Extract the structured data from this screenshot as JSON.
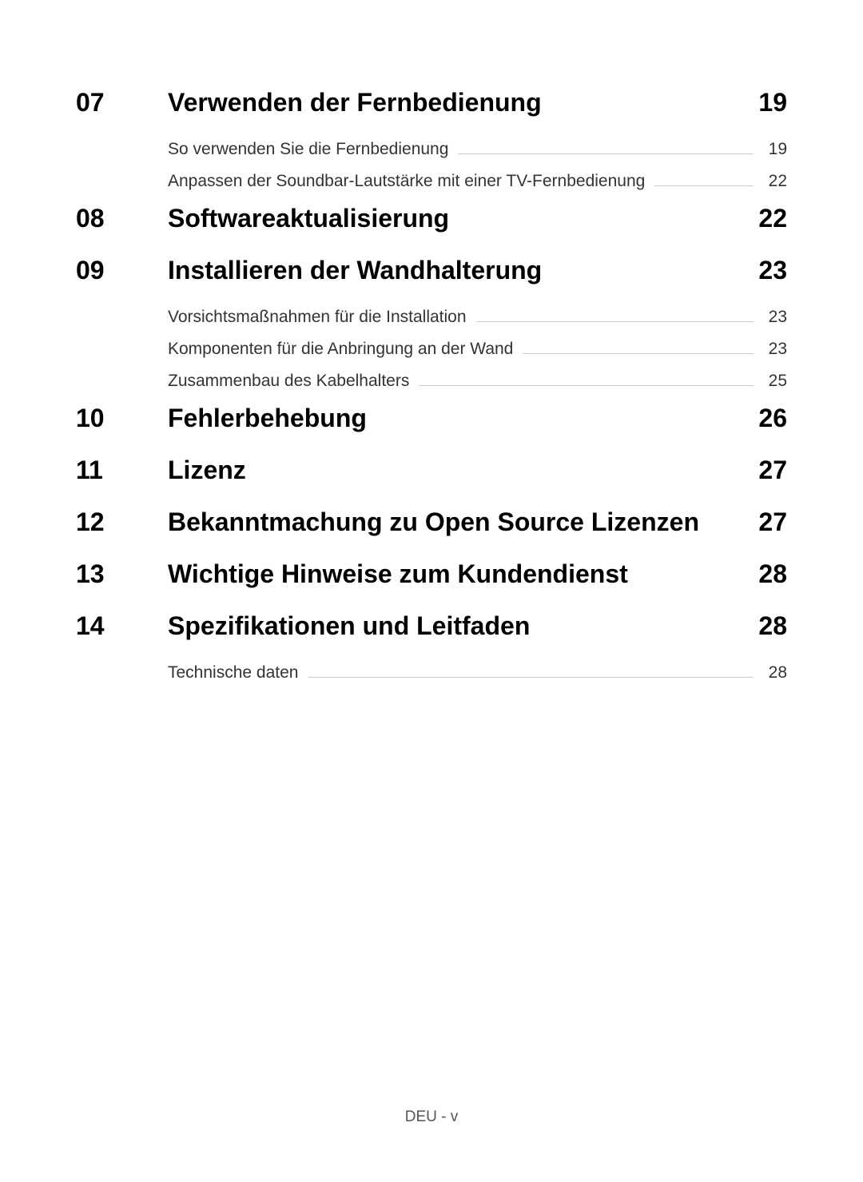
{
  "sections": [
    {
      "number": "07",
      "title": "Verwenden der Fernbedienung",
      "page": "19",
      "subs": [
        {
          "title": "So verwenden Sie die Fernbedienung",
          "page": "19"
        },
        {
          "title": "Anpassen der Soundbar-Lautstärke mit einer TV-Fernbedienung",
          "page": "22"
        }
      ]
    },
    {
      "number": "08",
      "title": "Softwareaktualisierung",
      "page": "22",
      "subs": []
    },
    {
      "number": "09",
      "title": "Installieren der Wandhalterung",
      "page": "23",
      "subs": [
        {
          "title": "Vorsichtsmaßnahmen für die Installation",
          "page": "23"
        },
        {
          "title": "Komponenten für die Anbringung an der Wand",
          "page": "23"
        },
        {
          "title": "Zusammenbau des Kabelhalters",
          "page": "25"
        }
      ]
    },
    {
      "number": "10",
      "title": "Fehlerbehebung",
      "page": "26",
      "subs": []
    },
    {
      "number": "11",
      "title": "Lizenz",
      "page": "27",
      "subs": []
    },
    {
      "number": "12",
      "title": "Bekanntmachung zu Open Source Lizenzen",
      "page": "27",
      "subs": []
    },
    {
      "number": "13",
      "title": "Wichtige Hinweise zum Kundendienst",
      "page": "28",
      "subs": []
    },
    {
      "number": "14",
      "title": "Spezifikationen und Leitfaden",
      "page": "28",
      "subs": [
        {
          "title": "Technische daten",
          "page": "28"
        }
      ]
    }
  ],
  "footer": "DEU - v"
}
